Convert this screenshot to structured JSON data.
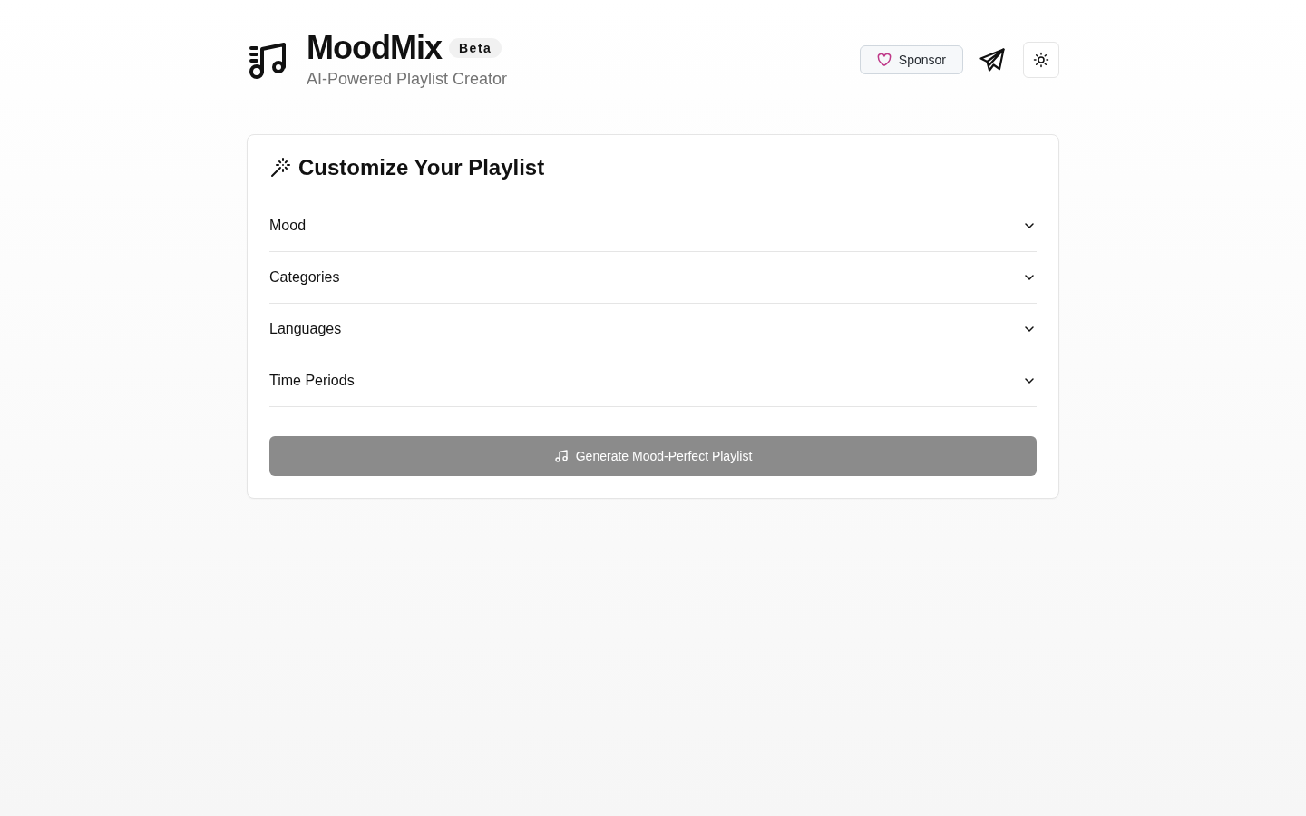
{
  "header": {
    "title": "MoodMix",
    "badge": "Beta",
    "subtitle": "AI-Powered Playlist Creator",
    "sponsor_button": "Sponsor"
  },
  "card": {
    "title": "Customize Your Playlist",
    "sections": [
      {
        "label": "Mood",
        "expanded": false
      },
      {
        "label": "Categories",
        "expanded": false
      },
      {
        "label": "Languages",
        "expanded": false
      },
      {
        "label": "Time Periods",
        "expanded": false
      }
    ],
    "generate_button": {
      "label": "Generate Mood-Perfect Playlist",
      "disabled": true
    }
  }
}
